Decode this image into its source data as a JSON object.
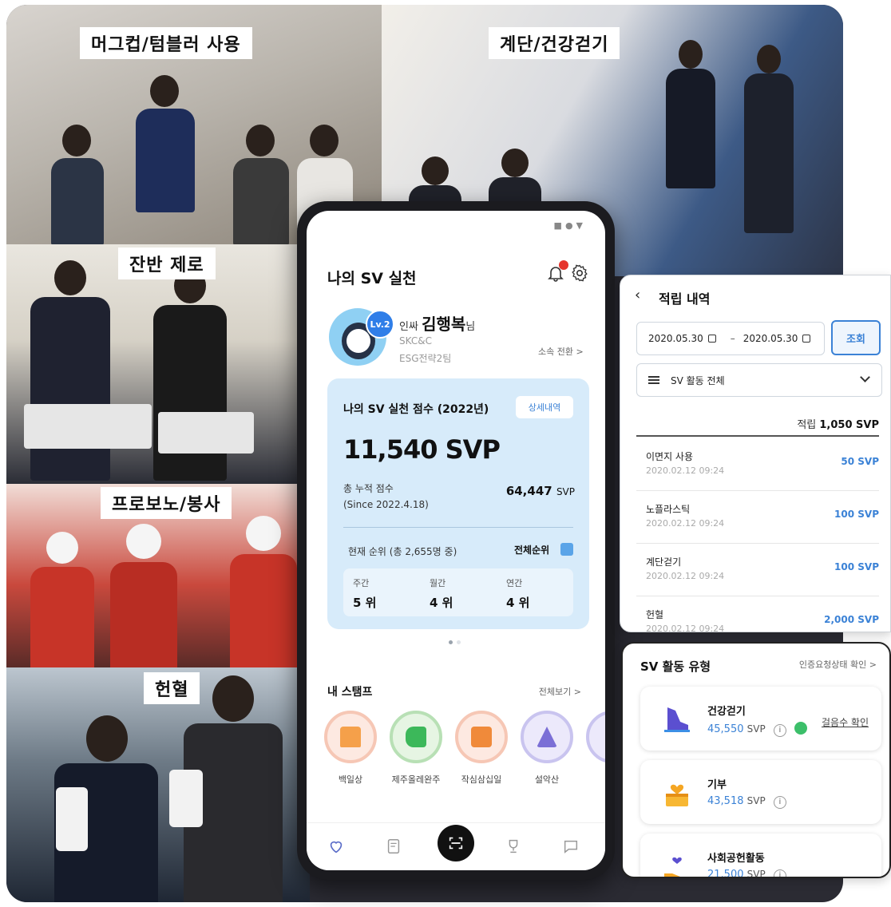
{
  "photos": {
    "mug": "머그컵/텀블러 사용",
    "stairs": "계단/건강걷기",
    "zero_waste": "잔반 제로",
    "probono": "프로보노/봉사",
    "blood": "헌혈"
  },
  "phone": {
    "title": "나의 SV 실천",
    "notification_count": "1",
    "profile": {
      "level": "Lv.2",
      "greeting": "인싸",
      "name": "김행복",
      "suffix": "님",
      "company": "SKC&C",
      "team": "ESG전략2팀",
      "switch": "소속 전환 >"
    },
    "score_card": {
      "title": "나의 SV 실천 점수 (2022년)",
      "detail_button": "상세내역",
      "score": "11,540 SVP",
      "cumulative_label": "총 누적 점수",
      "cumulative_since": "(Since 2022.4.18)",
      "cumulative_value": "64,447",
      "cumulative_unit": "SVP",
      "rank_label": "현재 순위 (총 2,655명 중)",
      "all_rank": "전체순위",
      "ranks": [
        {
          "label": "주간",
          "value": "5 위"
        },
        {
          "label": "월간",
          "value": "4 위"
        },
        {
          "label": "연간",
          "value": "4 위"
        }
      ]
    },
    "stamps": {
      "title": "내 스탬프",
      "view_all": "전체보기 >",
      "items": [
        {
          "label": "백일상",
          "icon": "cake-icon"
        },
        {
          "label": "제주올레완주",
          "icon": "sneaker-icon"
        },
        {
          "label": "작심삼십일",
          "icon": "calendar-30-icon"
        },
        {
          "label": "설악산",
          "icon": "mountain-flag-icon"
        }
      ]
    },
    "tabs": [
      "heart-plus-icon",
      "receipt-icon",
      "scan-icon",
      "trophy-icon",
      "message-icon"
    ]
  },
  "history": {
    "title": "적립 내역",
    "date_from": "2020.05.30",
    "date_to": "2020.05.30",
    "search": "조회",
    "filter": "SV 활동 전체",
    "total_label": "적립",
    "total_value": "1,050 SVP",
    "items": [
      {
        "name": "이면지 사용",
        "date": "2020.02.12 09:24",
        "points": "50 SVP"
      },
      {
        "name": "노플라스틱",
        "date": "2020.02.12 09:24",
        "points": "100 SVP"
      },
      {
        "name": "계단걷기",
        "date": "2020.02.12 09:24",
        "points": "100 SVP"
      },
      {
        "name": "헌혈",
        "date": "2020.02.12 09:24",
        "points": "2,000 SVP"
      }
    ]
  },
  "types": {
    "title": "SV 활동 유형",
    "link": "인증요청상태 확인 >",
    "items": [
      {
        "name": "건강걷기",
        "points": "45,550",
        "unit": "SVP",
        "action": "걸음수 확인"
      },
      {
        "name": "기부",
        "points": "43,518",
        "unit": "SVP"
      },
      {
        "name": "사회공헌활동",
        "points": "21,500",
        "unit": "SVP"
      }
    ]
  },
  "colors": {
    "accent": "#3b82d6",
    "card_bg": "#d7ebfa",
    "badge_red": "#e5342c"
  }
}
